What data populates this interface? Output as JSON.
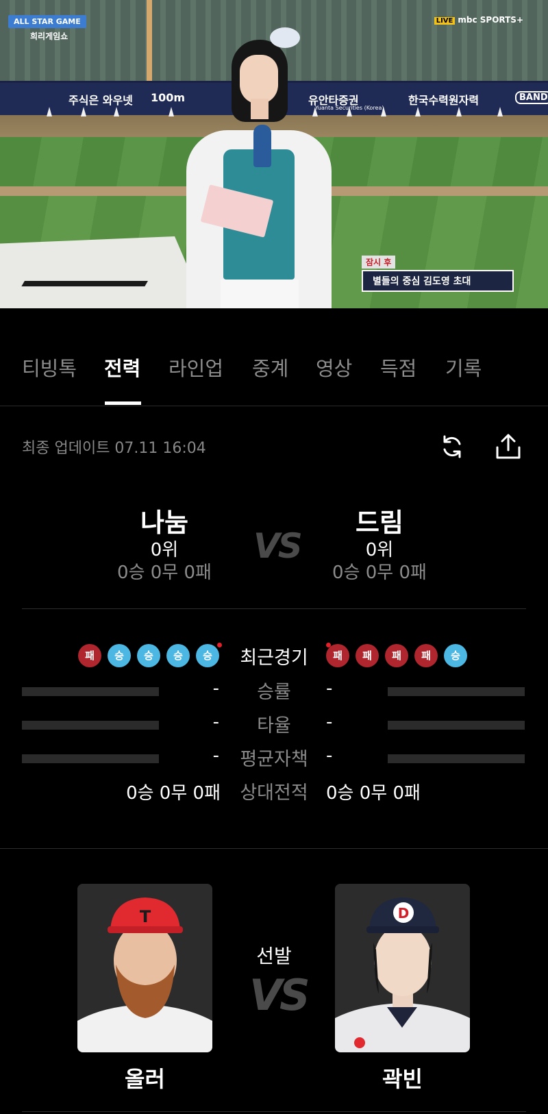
{
  "video": {
    "overlay_allstar": "ALL STAR GAME",
    "overlay_sub": "희리게임쇼",
    "overlay_live_badge": "LIVE",
    "overlay_broadcaster": "mbc SPORTS+",
    "board_left": "주식은 와우넷",
    "board_100m": "100m",
    "board_center": "유안타증권",
    "board_center_sub": "Yuanta Securities (Korea)",
    "board_right": "한국수력원자력",
    "board_far_right": "BAND",
    "caption_top": "잠시 후",
    "caption_main": "별들의 중심 김도영 초대"
  },
  "tabs": [
    {
      "label": "티빙톡",
      "active": false
    },
    {
      "label": "전력",
      "active": true
    },
    {
      "label": "라인업",
      "active": false
    },
    {
      "label": "중계",
      "active": false
    },
    {
      "label": "영상",
      "active": false
    },
    {
      "label": "득점",
      "active": false
    },
    {
      "label": "기록",
      "active": false
    }
  ],
  "update": {
    "label": "최종 업데이트 07.11 16:04"
  },
  "icons": {
    "refresh": "refresh-icon",
    "share": "share-icon"
  },
  "teams": {
    "home": {
      "name": "나눔",
      "rank": "0위",
      "record": "0승 0무 0패"
    },
    "away": {
      "name": "드림",
      "rank": "0위",
      "record": "0승 0무 0패"
    },
    "vs": "VS"
  },
  "recent": {
    "label": "최근경기",
    "home": [
      "패",
      "승",
      "승",
      "승",
      "승"
    ],
    "away": [
      "패",
      "패",
      "패",
      "패",
      "승"
    ]
  },
  "colors": {
    "win": "#4cb7e2",
    "loss": "#b0262e",
    "new_dot": "#e3212b"
  },
  "stats": [
    {
      "label": "승률",
      "home": "-",
      "away": "-"
    },
    {
      "label": "타율",
      "home": "-",
      "away": "-"
    },
    {
      "label": "평균자책",
      "home": "-",
      "away": "-"
    }
  ],
  "head_to_head": {
    "label": "상대전적",
    "home": "0승 0무 0패",
    "away": "0승 0무 0패"
  },
  "starters": {
    "label": "선발",
    "vs": "VS",
    "home": {
      "name": "올러",
      "cap_letter": "T"
    },
    "away": {
      "name": "곽빈",
      "cap_letter": "D"
    }
  }
}
